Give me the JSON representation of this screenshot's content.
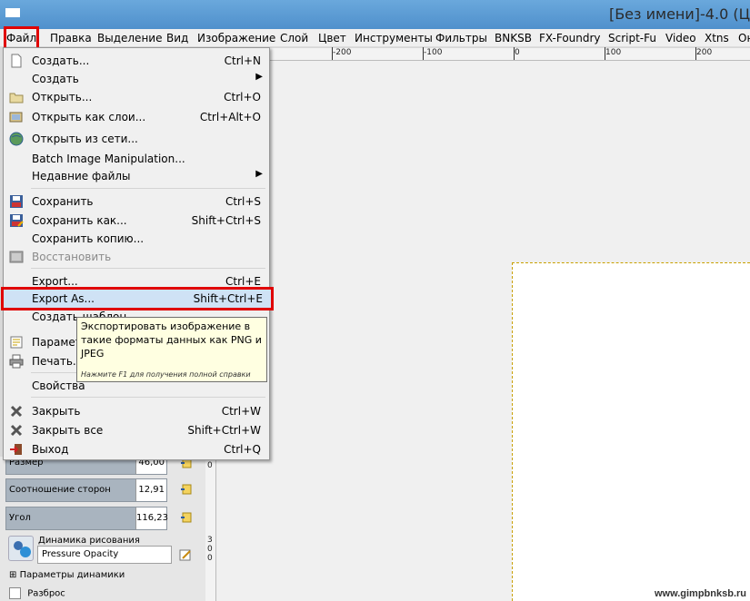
{
  "window": {
    "title": "[Без имени]-4.0 (Ц"
  },
  "menubar": {
    "items": [
      "Файл",
      "Правка",
      "Выделение",
      "Вид",
      "Изображение",
      "Слой",
      "Цвет",
      "Инструменты",
      "Фильтры",
      "BNKSB",
      "FX-Foundry",
      "Script-Fu",
      "Video",
      "Xtns",
      "Он"
    ],
    "active": "Файл"
  },
  "file_menu": {
    "items": [
      {
        "label": "Создать...",
        "shortcut": "Ctrl+N",
        "icon": "new-file-icon"
      },
      {
        "label": "Создать",
        "shortcut": "",
        "submenu": "▶"
      },
      {
        "label": "Открыть...",
        "shortcut": "Ctrl+O",
        "icon": "open-folder-icon"
      },
      {
        "label": "Открыть как слои...",
        "shortcut": "Ctrl+Alt+O",
        "icon": "open-as-layers-icon"
      },
      {
        "label": "Открыть из сети...",
        "shortcut": "",
        "icon": "globe-icon"
      },
      {
        "label": "Batch Image Manipulation...",
        "shortcut": ""
      },
      {
        "label": "Недавние файлы",
        "shortcut": "",
        "submenu": "▶"
      },
      {
        "label": "Сохранить",
        "shortcut": "Ctrl+S",
        "icon": "save-icon"
      },
      {
        "label": "Сохранить как...",
        "shortcut": "Shift+Ctrl+S",
        "icon": "save-as-icon"
      },
      {
        "label": "Сохранить копию...",
        "shortcut": ""
      },
      {
        "label": "Восстановить",
        "shortcut": "",
        "icon": "revert-icon",
        "disabled": true
      },
      {
        "label": "Export...",
        "shortcut": "Ctrl+E"
      },
      {
        "label": "Export As...",
        "shortcut": "Shift+Ctrl+E",
        "highlighted": true
      },
      {
        "label": "Создать шаблон...",
        "shortcut": ""
      },
      {
        "label": "Парамет...",
        "shortcut": "",
        "icon": "page-setup-icon"
      },
      {
        "label": "Печать...",
        "shortcut": "",
        "icon": "printer-icon"
      },
      {
        "label": "Свойства",
        "shortcut": ""
      },
      {
        "label": "Закрыть",
        "shortcut": "Ctrl+W",
        "icon": "close-x-icon"
      },
      {
        "label": "Закрыть все",
        "shortcut": "Shift+Ctrl+W",
        "icon": "close-all-icon"
      },
      {
        "label": "Выход",
        "shortcut": "Ctrl+Q",
        "icon": "quit-icon"
      }
    ]
  },
  "tooltip": {
    "text": "Экспортировать изображение в такие форматы данных как PNG и JPEG",
    "hint": "Нажмите F1 для получения полной справки"
  },
  "ruler": {
    "top_labels": [
      "-200",
      "-100",
      "0",
      "100",
      "200"
    ],
    "left_labels": [
      "0",
      "3",
      "0",
      "0"
    ]
  },
  "tool_options": {
    "size_label": "Размер",
    "size_value": "46,00",
    "aspect_label": "Соотношение сторон",
    "aspect_value": "12,91",
    "angle_label": "Угол",
    "angle_value": "116,23",
    "dynamics_label": "Динамика рисования",
    "dynamics_value": "Pressure Opacity",
    "dynamics_params": "Параметры динамики",
    "scatter_label": "Разброс"
  },
  "watermark": "www.gimpbnksb.ru"
}
